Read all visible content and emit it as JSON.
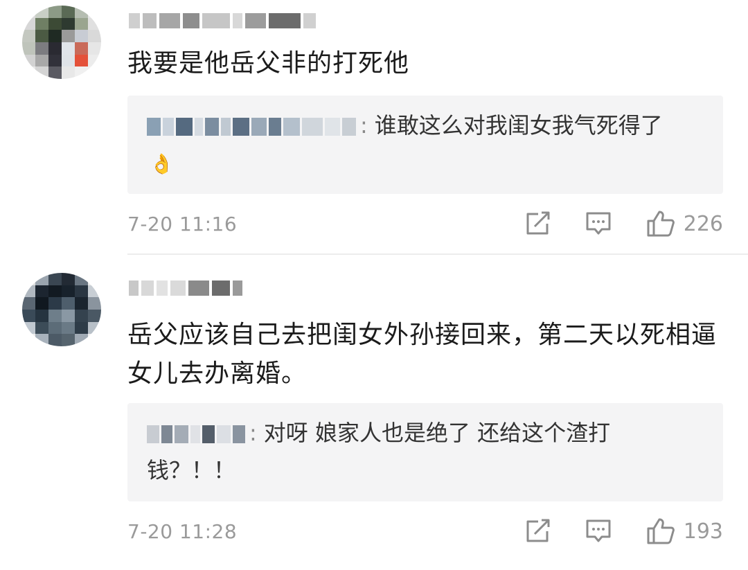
{
  "colors": {
    "reply_bg": "#f4f4f5",
    "meta_gray": "#9a9a9a",
    "text": "#1b1b1b"
  },
  "comments": [
    {
      "body": "我要是他岳父非的打死他",
      "reply": {
        "text": "谁敢这么对我闺女我气死得了",
        "emoji": "👌"
      },
      "timestamp": "7-20 11:16",
      "likes": "226",
      "icons": [
        "share-icon",
        "comment-icon",
        "like-icon"
      ]
    },
    {
      "body": "岳父应该自己去把闺女外孙接回来，第二天以死相逼女儿去办离婚。",
      "reply": {
        "text": "对呀 娘家人也是绝了 还给这个渣打钱？！！"
      },
      "timestamp": "7-20 11:28",
      "likes": "193",
      "icons": [
        "share-icon",
        "comment-icon",
        "like-icon"
      ]
    }
  ]
}
